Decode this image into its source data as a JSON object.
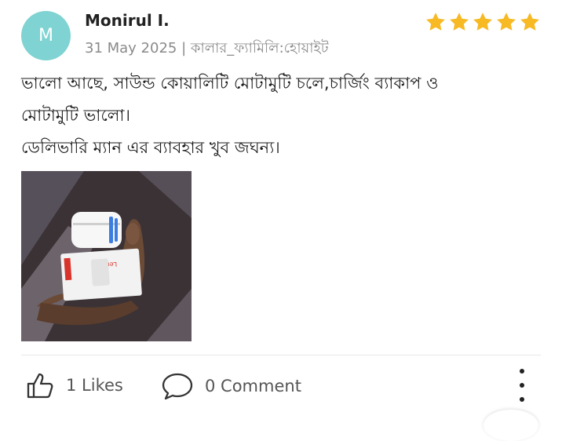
{
  "reviewer": {
    "initial": "M",
    "name": "Monirul I.",
    "date": "31 May 2025",
    "separator": "|",
    "variant": "কালার_ফ্যামিলি:হোয়াইট",
    "rating": 5,
    "avatar_color": "#7fd3d2"
  },
  "review": {
    "lines": [
      "ভালো আছে, সাউন্ড কোয়ালিটি মোটামুটি চলে,চার্জিং ব্যাকাপ ও",
      "মোটামুটি ভালো।",
      "ডেলিভারি ম্যান এর ব্যাবহার খুব জঘন্য।"
    ]
  },
  "photo": {
    "box_brand": "Lenovo"
  },
  "actions": {
    "likes_label": "1 Likes",
    "comments_label": "0 Comment"
  },
  "colors": {
    "star": "#f7b924",
    "meta_text": "#8a8a8a"
  }
}
